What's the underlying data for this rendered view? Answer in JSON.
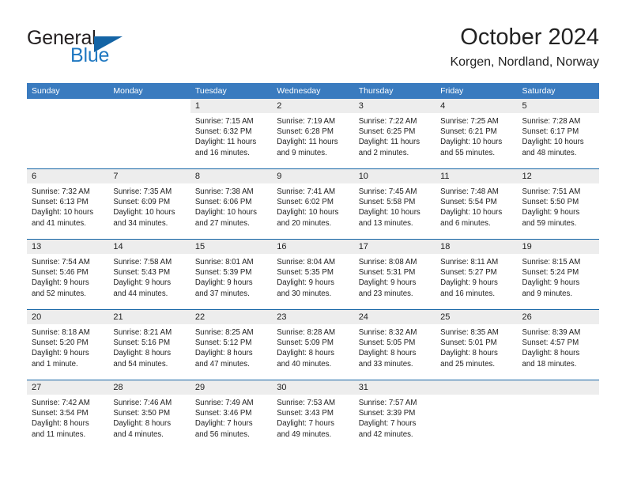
{
  "brand": {
    "name_part1": "General",
    "name_part2": "Blue",
    "logo_icon": "triangle-logo-icon"
  },
  "header": {
    "title": "October 2024",
    "location": "Korgen, Nordland, Norway"
  },
  "calendar": {
    "weekday_headers": [
      "Sunday",
      "Monday",
      "Tuesday",
      "Wednesday",
      "Thursday",
      "Friday",
      "Saturday"
    ],
    "colors": {
      "header_band": "#3a7bbf",
      "week_separator": "#1464a5",
      "day_band": "#ededed",
      "brand_blue": "#1f78c1"
    },
    "weeks": [
      [
        {
          "day": "",
          "lines": []
        },
        {
          "day": "",
          "lines": []
        },
        {
          "day": "1",
          "lines": [
            "Sunrise: 7:15 AM",
            "Sunset: 6:32 PM",
            "Daylight: 11 hours",
            "and 16 minutes."
          ]
        },
        {
          "day": "2",
          "lines": [
            "Sunrise: 7:19 AM",
            "Sunset: 6:28 PM",
            "Daylight: 11 hours",
            "and 9 minutes."
          ]
        },
        {
          "day": "3",
          "lines": [
            "Sunrise: 7:22 AM",
            "Sunset: 6:25 PM",
            "Daylight: 11 hours",
            "and 2 minutes."
          ]
        },
        {
          "day": "4",
          "lines": [
            "Sunrise: 7:25 AM",
            "Sunset: 6:21 PM",
            "Daylight: 10 hours",
            "and 55 minutes."
          ]
        },
        {
          "day": "5",
          "lines": [
            "Sunrise: 7:28 AM",
            "Sunset: 6:17 PM",
            "Daylight: 10 hours",
            "and 48 minutes."
          ]
        }
      ],
      [
        {
          "day": "6",
          "lines": [
            "Sunrise: 7:32 AM",
            "Sunset: 6:13 PM",
            "Daylight: 10 hours",
            "and 41 minutes."
          ]
        },
        {
          "day": "7",
          "lines": [
            "Sunrise: 7:35 AM",
            "Sunset: 6:09 PM",
            "Daylight: 10 hours",
            "and 34 minutes."
          ]
        },
        {
          "day": "8",
          "lines": [
            "Sunrise: 7:38 AM",
            "Sunset: 6:06 PM",
            "Daylight: 10 hours",
            "and 27 minutes."
          ]
        },
        {
          "day": "9",
          "lines": [
            "Sunrise: 7:41 AM",
            "Sunset: 6:02 PM",
            "Daylight: 10 hours",
            "and 20 minutes."
          ]
        },
        {
          "day": "10",
          "lines": [
            "Sunrise: 7:45 AM",
            "Sunset: 5:58 PM",
            "Daylight: 10 hours",
            "and 13 minutes."
          ]
        },
        {
          "day": "11",
          "lines": [
            "Sunrise: 7:48 AM",
            "Sunset: 5:54 PM",
            "Daylight: 10 hours",
            "and 6 minutes."
          ]
        },
        {
          "day": "12",
          "lines": [
            "Sunrise: 7:51 AM",
            "Sunset: 5:50 PM",
            "Daylight: 9 hours",
            "and 59 minutes."
          ]
        }
      ],
      [
        {
          "day": "13",
          "lines": [
            "Sunrise: 7:54 AM",
            "Sunset: 5:46 PM",
            "Daylight: 9 hours",
            "and 52 minutes."
          ]
        },
        {
          "day": "14",
          "lines": [
            "Sunrise: 7:58 AM",
            "Sunset: 5:43 PM",
            "Daylight: 9 hours",
            "and 44 minutes."
          ]
        },
        {
          "day": "15",
          "lines": [
            "Sunrise: 8:01 AM",
            "Sunset: 5:39 PM",
            "Daylight: 9 hours",
            "and 37 minutes."
          ]
        },
        {
          "day": "16",
          "lines": [
            "Sunrise: 8:04 AM",
            "Sunset: 5:35 PM",
            "Daylight: 9 hours",
            "and 30 minutes."
          ]
        },
        {
          "day": "17",
          "lines": [
            "Sunrise: 8:08 AM",
            "Sunset: 5:31 PM",
            "Daylight: 9 hours",
            "and 23 minutes."
          ]
        },
        {
          "day": "18",
          "lines": [
            "Sunrise: 8:11 AM",
            "Sunset: 5:27 PM",
            "Daylight: 9 hours",
            "and 16 minutes."
          ]
        },
        {
          "day": "19",
          "lines": [
            "Sunrise: 8:15 AM",
            "Sunset: 5:24 PM",
            "Daylight: 9 hours",
            "and 9 minutes."
          ]
        }
      ],
      [
        {
          "day": "20",
          "lines": [
            "Sunrise: 8:18 AM",
            "Sunset: 5:20 PM",
            "Daylight: 9 hours",
            "and 1 minute."
          ]
        },
        {
          "day": "21",
          "lines": [
            "Sunrise: 8:21 AM",
            "Sunset: 5:16 PM",
            "Daylight: 8 hours",
            "and 54 minutes."
          ]
        },
        {
          "day": "22",
          "lines": [
            "Sunrise: 8:25 AM",
            "Sunset: 5:12 PM",
            "Daylight: 8 hours",
            "and 47 minutes."
          ]
        },
        {
          "day": "23",
          "lines": [
            "Sunrise: 8:28 AM",
            "Sunset: 5:09 PM",
            "Daylight: 8 hours",
            "and 40 minutes."
          ]
        },
        {
          "day": "24",
          "lines": [
            "Sunrise: 8:32 AM",
            "Sunset: 5:05 PM",
            "Daylight: 8 hours",
            "and 33 minutes."
          ]
        },
        {
          "day": "25",
          "lines": [
            "Sunrise: 8:35 AM",
            "Sunset: 5:01 PM",
            "Daylight: 8 hours",
            "and 25 minutes."
          ]
        },
        {
          "day": "26",
          "lines": [
            "Sunrise: 8:39 AM",
            "Sunset: 4:57 PM",
            "Daylight: 8 hours",
            "and 18 minutes."
          ]
        }
      ],
      [
        {
          "day": "27",
          "lines": [
            "Sunrise: 7:42 AM",
            "Sunset: 3:54 PM",
            "Daylight: 8 hours",
            "and 11 minutes."
          ]
        },
        {
          "day": "28",
          "lines": [
            "Sunrise: 7:46 AM",
            "Sunset: 3:50 PM",
            "Daylight: 8 hours",
            "and 4 minutes."
          ]
        },
        {
          "day": "29",
          "lines": [
            "Sunrise: 7:49 AM",
            "Sunset: 3:46 PM",
            "Daylight: 7 hours",
            "and 56 minutes."
          ]
        },
        {
          "day": "30",
          "lines": [
            "Sunrise: 7:53 AM",
            "Sunset: 3:43 PM",
            "Daylight: 7 hours",
            "and 49 minutes."
          ]
        },
        {
          "day": "31",
          "lines": [
            "Sunrise: 7:57 AM",
            "Sunset: 3:39 PM",
            "Daylight: 7 hours",
            "and 42 minutes."
          ]
        },
        {
          "day": "",
          "lines": []
        },
        {
          "day": "",
          "lines": []
        }
      ]
    ]
  }
}
